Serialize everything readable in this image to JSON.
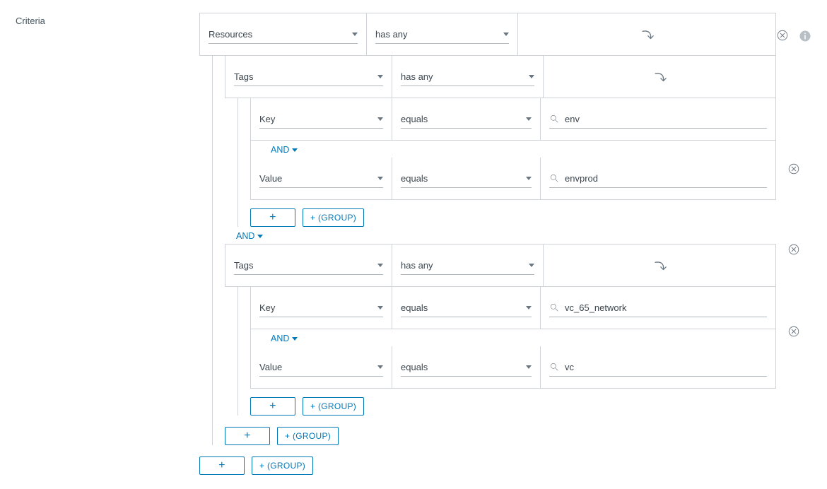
{
  "label": "Criteria",
  "addBtn": "+",
  "groupBtn": "+ (GROUP)",
  "join": "AND",
  "root": {
    "subject": "Resources",
    "op": "has any"
  },
  "tags1": {
    "subject": "Tags",
    "op": "has any",
    "key": {
      "field": "Key",
      "op": "equals",
      "value": "env"
    },
    "value": {
      "field": "Value",
      "op": "equals",
      "value": "envprod"
    }
  },
  "tags2": {
    "subject": "Tags",
    "op": "has any",
    "key": {
      "field": "Key",
      "op": "equals",
      "value": "vc_65_network"
    },
    "value": {
      "field": "Value",
      "op": "equals",
      "value": "vc"
    }
  }
}
